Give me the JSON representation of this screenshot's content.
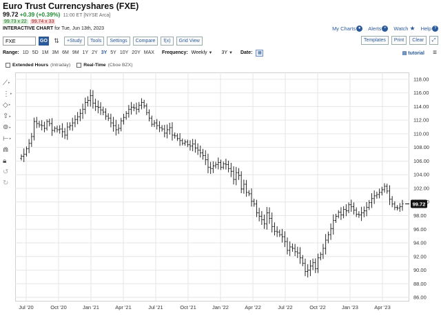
{
  "header": {
    "title": "Euro Trust Currencyshares (FXE)",
    "price": "99.72",
    "change": "+0.39 (+0.39%)",
    "timestamp": "11:00 ET [NYSE Arca]",
    "bid": "99.73 x 22",
    "ask": "99.74 x 33",
    "chart_label": "INTERACTIVE CHART",
    "chart_date": "for Tue, Jun 13th, 2023"
  },
  "toplinks": {
    "my_charts": "My Charts",
    "alerts": "Alerts",
    "watch": "Watch",
    "help": "Help"
  },
  "toolbar": {
    "symbol_value": "FXE",
    "go_label": "GO",
    "study_label": "+Study",
    "tools_label": "Tools",
    "settings_label": "Settings",
    "compare_label": "Compare",
    "fx_label": "f(x)",
    "grid_label": "Grid View",
    "templates_label": "Templates",
    "print_label": "Print",
    "clear_label": "Clear"
  },
  "rangebar": {
    "range_label": "Range:",
    "ranges": [
      "1D",
      "5D",
      "1M",
      "3M",
      "6M",
      "9M",
      "1Y",
      "2Y",
      "3Y",
      "5Y",
      "10Y",
      "20Y",
      "MAX"
    ],
    "active_range": "3Y",
    "frequency_label": "Frequency:",
    "frequency_value": "Weekly",
    "period_value": "3Y",
    "date_label": "Date:",
    "tutorial_label": "tutorial"
  },
  "checks": {
    "extended_label": "Extended Hours",
    "extended_note": "(Intraday)",
    "realtime_label": "Real-Time",
    "realtime_note": "(Cboe BZX)"
  },
  "chart_data": {
    "type": "ohlc-bar",
    "x_ticks": [
      "Jul '20",
      "Oct '20",
      "Jan '21",
      "Apr '21",
      "Jul '21",
      "Oct '21",
      "Jan '22",
      "Apr '22",
      "Jul '22",
      "Oct '22",
      "Jan '23",
      "Apr '23"
    ],
    "y_ticks": [
      "118.00",
      "116.00",
      "114.00",
      "112.00",
      "110.00",
      "108.00",
      "106.00",
      "104.00",
      "102.00",
      "100.00",
      "98.00",
      "96.00",
      "94.00",
      "92.00",
      "90.00",
      "88.00",
      "86.00"
    ],
    "ylim": [
      85.5,
      119
    ],
    "last_price_label": "99.72",
    "series_close": [
      106.7,
      107.0,
      107.8,
      108.6,
      109.6,
      111.8,
      111.5,
      111.3,
      111.2,
      110.8,
      111.8,
      111.5,
      110.5,
      110.8,
      110.6,
      110.7,
      110.3,
      109.8,
      111.0,
      111.2,
      111.6,
      112.1,
      112.5,
      113.0,
      113.6,
      114.6,
      114.9,
      115.6,
      114.5,
      114.0,
      113.9,
      113.5,
      113.2,
      112.6,
      112.3,
      111.6,
      111.2,
      110.6,
      110.8,
      111.9,
      112.4,
      113.0,
      113.6,
      113.9,
      113.8,
      113.6,
      114.2,
      114.6,
      114.1,
      113.1,
      112.3,
      111.4,
      111.6,
      111.2,
      110.9,
      110.7,
      110.1,
      110.6,
      110.9,
      109.8,
      109.7,
      109.3,
      109.0,
      108.6,
      108.8,
      108.4,
      108.2,
      108.5,
      107.9,
      107.6,
      107.2,
      106.8,
      106.2,
      105.1,
      104.9,
      105.3,
      105.5,
      105.8,
      105.1,
      105.6,
      105.5,
      104.9,
      104.5,
      103.3,
      104.3,
      103.9,
      101.9,
      102.6,
      101.4,
      101.2,
      100.1,
      99.7,
      98.4,
      97.9,
      97.4,
      96.8,
      98.4,
      97.6,
      96.4,
      95.7,
      95.6,
      95.2,
      94.9,
      94.2,
      92.9,
      93.4,
      93.2,
      92.7,
      92.5,
      91.8,
      91.0,
      89.8,
      90.0,
      90.6,
      91.1,
      90.2,
      91.8,
      92.3,
      93.2,
      94.4,
      95.2,
      96.1,
      97.3,
      97.9,
      98.5,
      98.1,
      98.9,
      98.7,
      99.6,
      99.3,
      98.8,
      98.2,
      98.1,
      98.4,
      98.7,
      99.2,
      99.9,
      100.5,
      100.9,
      101.1,
      101.4,
      101.8,
      102.3,
      101.6,
      100.4,
      99.7,
      99.2,
      99.1,
      99.3,
      99.72
    ]
  }
}
